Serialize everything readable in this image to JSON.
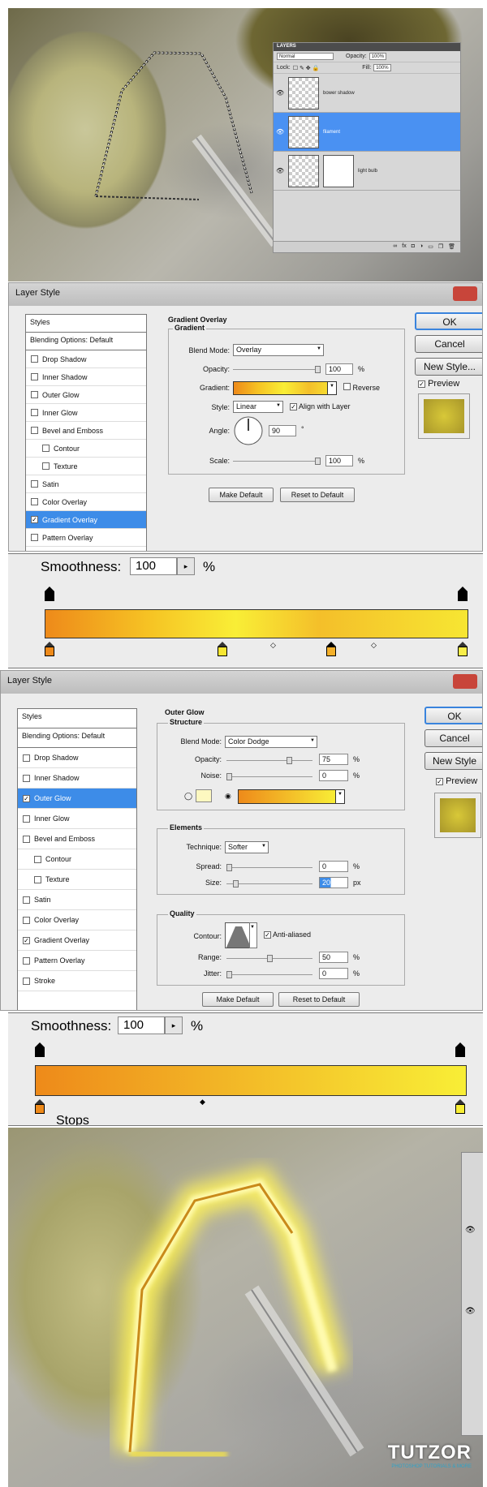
{
  "layers_palette": {
    "title": "LAYERS",
    "blend_mode": "Normal",
    "opacity_label": "Opacity:",
    "opacity_value": "100%",
    "lock_label": "Lock:",
    "fill_label": "Fill:",
    "fill_value": "100%",
    "layers": [
      {
        "name": "bower shadow",
        "active": false
      },
      {
        "name": "filament",
        "active": true
      },
      {
        "name": "light bulb",
        "active": false
      }
    ]
  },
  "dialog1": {
    "title": "Layer Style",
    "styles_header": "Styles",
    "blending_options": "Blending Options: Default",
    "items": [
      {
        "label": "Drop Shadow",
        "checked": false,
        "indent": false,
        "selected": false
      },
      {
        "label": "Inner Shadow",
        "checked": false,
        "indent": false,
        "selected": false
      },
      {
        "label": "Outer Glow",
        "checked": false,
        "indent": false,
        "selected": false
      },
      {
        "label": "Inner Glow",
        "checked": false,
        "indent": false,
        "selected": false
      },
      {
        "label": "Bevel and Emboss",
        "checked": false,
        "indent": false,
        "selected": false
      },
      {
        "label": "Contour",
        "checked": false,
        "indent": true,
        "selected": false
      },
      {
        "label": "Texture",
        "checked": false,
        "indent": true,
        "selected": false
      },
      {
        "label": "Satin",
        "checked": false,
        "indent": false,
        "selected": false
      },
      {
        "label": "Color Overlay",
        "checked": false,
        "indent": false,
        "selected": false
      },
      {
        "label": "Gradient Overlay",
        "checked": true,
        "indent": false,
        "selected": true
      },
      {
        "label": "Pattern Overlay",
        "checked": false,
        "indent": false,
        "selected": false
      }
    ],
    "section_title": "Gradient Overlay",
    "group_title": "Gradient",
    "blend_mode_label": "Blend Mode:",
    "blend_mode_value": "Overlay",
    "opacity_label": "Opacity:",
    "opacity_value": "100",
    "opacity_level": 100,
    "percent": "%",
    "gradient_label": "Gradient:",
    "reverse_label": "Reverse",
    "style_label": "Style:",
    "style_value": "Linear",
    "align_label": "Align with Layer",
    "angle_label": "Angle:",
    "angle_value": "90",
    "degree": "°",
    "scale_label": "Scale:",
    "scale_value": "100",
    "scale_level": 100,
    "make_default": "Make Default",
    "reset_default": "Reset to Default",
    "ok": "OK",
    "cancel": "Cancel",
    "new_style": "New Style...",
    "preview": "Preview"
  },
  "smooth1": {
    "label": "Smoothness:",
    "value": "100",
    "arrow": "▸",
    "percent": "%",
    "colors": [
      "#ee8a1a",
      "#f6c424",
      "#f9ee36",
      "#f4bf2a",
      "#f7e632"
    ]
  },
  "dialog2": {
    "title": "Layer Style",
    "styles_header": "Styles",
    "blending_options": "Blending Options: Default",
    "items": [
      {
        "label": "Drop Shadow",
        "checked": false,
        "indent": false,
        "selected": false
      },
      {
        "label": "Inner Shadow",
        "checked": false,
        "indent": false,
        "selected": false
      },
      {
        "label": "Outer Glow",
        "checked": true,
        "indent": false,
        "selected": true
      },
      {
        "label": "Inner Glow",
        "checked": false,
        "indent": false,
        "selected": false
      },
      {
        "label": "Bevel and Emboss",
        "checked": false,
        "indent": false,
        "selected": false
      },
      {
        "label": "Contour",
        "checked": false,
        "indent": true,
        "selected": false
      },
      {
        "label": "Texture",
        "checked": false,
        "indent": true,
        "selected": false
      },
      {
        "label": "Satin",
        "checked": false,
        "indent": false,
        "selected": false
      },
      {
        "label": "Color Overlay",
        "checked": false,
        "indent": false,
        "selected": false
      },
      {
        "label": "Gradient Overlay",
        "checked": true,
        "indent": false,
        "selected": false
      },
      {
        "label": "Pattern Overlay",
        "checked": false,
        "indent": false,
        "selected": false
      },
      {
        "label": "Stroke",
        "checked": false,
        "indent": false,
        "selected": false
      }
    ],
    "section_title": "Outer Glow",
    "structure_title": "Structure",
    "blend_mode_label": "Blend Mode:",
    "blend_mode_value": "Color Dodge",
    "opacity_label": "Opacity:",
    "opacity_value": "75",
    "opacity_level": 75,
    "noise_label": "Noise:",
    "noise_value": "0",
    "noise_level": 0,
    "percent": "%",
    "elements_title": "Elements",
    "technique_label": "Technique:",
    "technique_value": "Softer",
    "spread_label": "Spread:",
    "spread_value": "0",
    "spread_level": 0,
    "size_label": "Size:",
    "size_value": "20",
    "size_level": 8,
    "px": "px",
    "quality_title": "Quality",
    "contour_label": "Contour:",
    "antialiased_label": "Anti-aliased",
    "range_label": "Range:",
    "range_value": "50",
    "range_level": 50,
    "jitter_label": "Jitter:",
    "jitter_value": "0",
    "jitter_level": 0,
    "make_default": "Make Default",
    "reset_default": "Reset to Default",
    "ok": "OK",
    "cancel": "Cancel",
    "new_style": "New Style",
    "preview": "Preview"
  },
  "smooth2": {
    "label": "Smoothness:",
    "value": "100",
    "arrow": "▸",
    "percent": "%",
    "stops_label": "Stops",
    "colors": [
      "#ee8a1a",
      "#f8ee36"
    ]
  },
  "watermark": {
    "logo": "TUTZOR",
    "tagline": "PHOTOSHOP TUTORIALS & MORE"
  },
  "colors": {
    "accent_blue": "#3d8ce8",
    "glow_yellow": "#fff35a",
    "filament_orange": "#c98a1a"
  }
}
